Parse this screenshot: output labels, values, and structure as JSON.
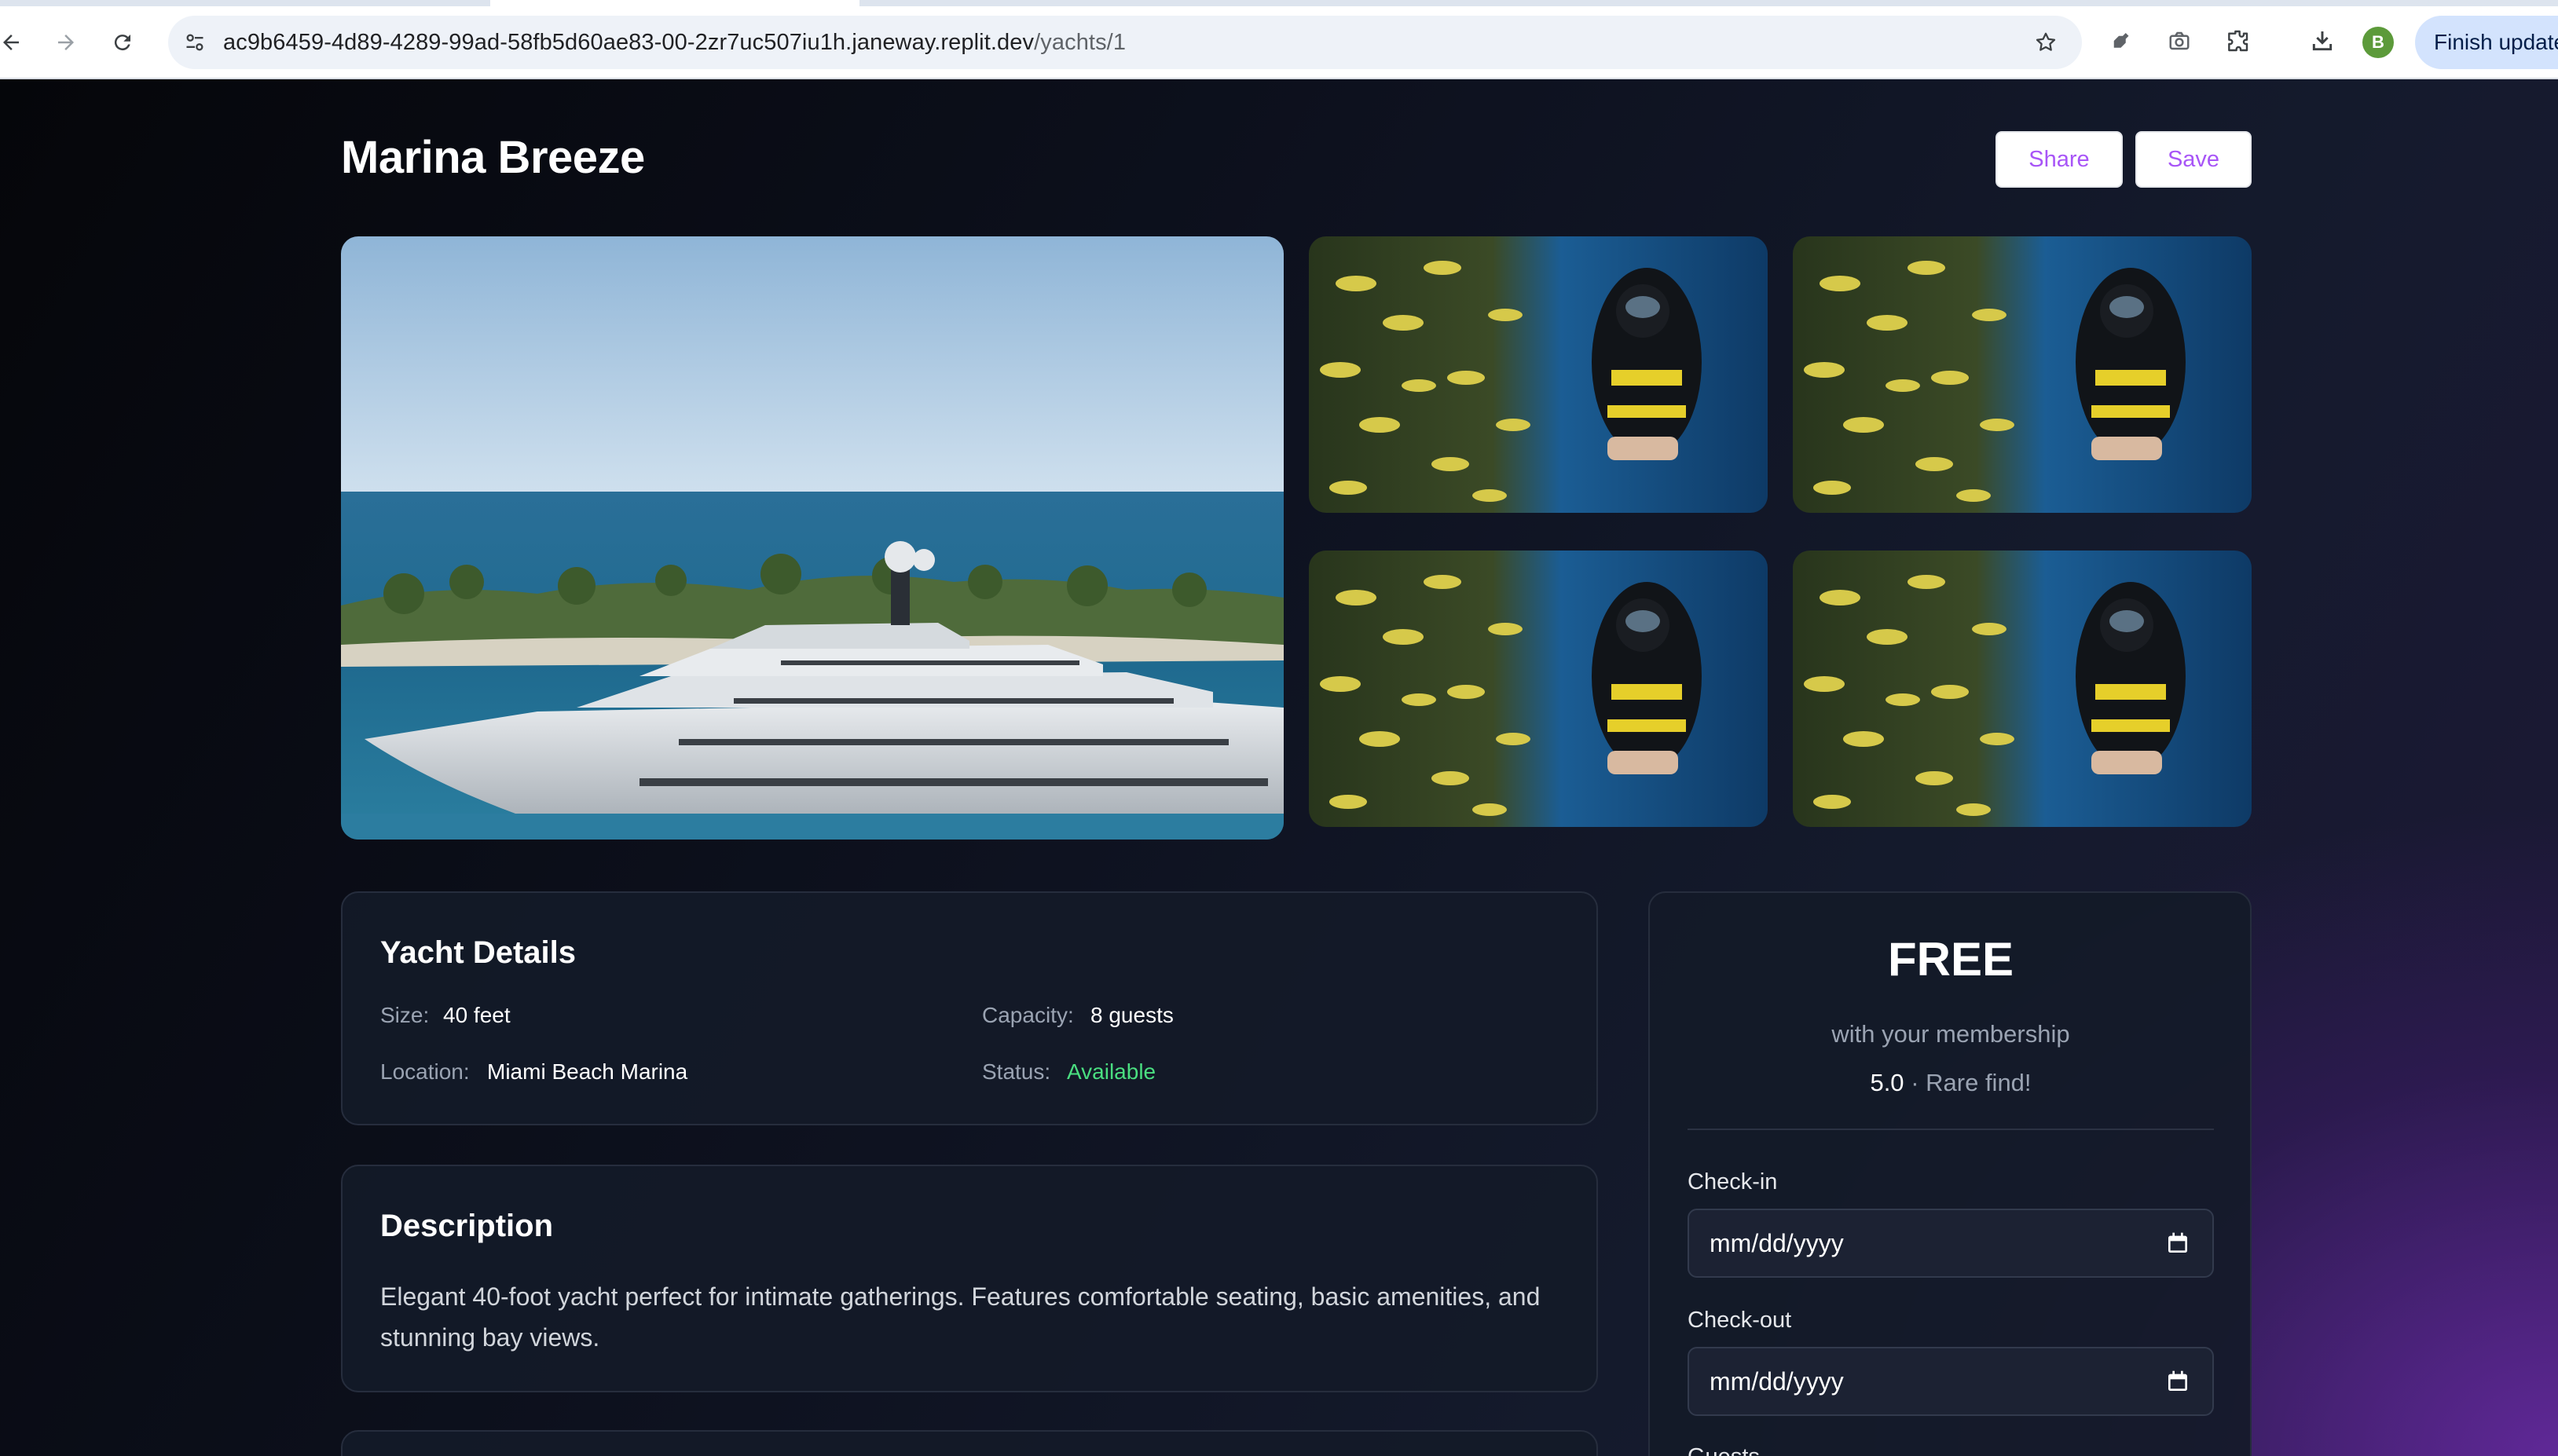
{
  "browser": {
    "url_host": "ac9b6459-4d89-4289-99ad-58fb5d60ae83-00-2zr7uc507iu1h.janeway.replit.dev",
    "url_path": "/yachts/1",
    "profile_initial": "B",
    "update_button": "Finish update"
  },
  "header": {
    "title": "Marina Breeze",
    "share_label": "Share",
    "save_label": "Save"
  },
  "details": {
    "heading": "Yacht Details",
    "size_label": "Size:",
    "size_value": "40 feet",
    "capacity_label": "Capacity:",
    "capacity_value": "8 guests",
    "location_label": "Location:",
    "location_value": "Miami Beach Marina",
    "status_label": "Status:",
    "status_value": "Available"
  },
  "description": {
    "heading": "Description",
    "text": "Elegant 40-foot yacht perfect for intimate gatherings. Features comfortable seating, basic amenities, and stunning bay views."
  },
  "booking": {
    "price": "FREE",
    "price_note": "with your membership",
    "rating": "5.0",
    "rating_separator": "·",
    "rating_note": "Rare find!",
    "checkin_label": "Check-in",
    "checkin_value": "mm/dd/yyyy",
    "checkout_label": "Check-out",
    "checkout_value": "mm/dd/yyyy",
    "guests_label": "Guests"
  },
  "colors": {
    "accent": "#a855f7",
    "status_available": "#4ade80",
    "card_bg": "#141a28"
  }
}
